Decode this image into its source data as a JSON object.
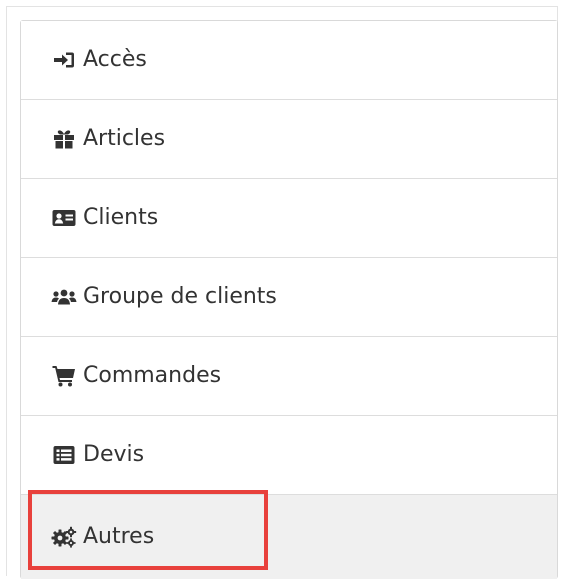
{
  "menu": {
    "items": [
      {
        "label": "Accès",
        "icon": "sign-in-icon"
      },
      {
        "label": "Articles",
        "icon": "gift-icon"
      },
      {
        "label": "Clients",
        "icon": "id-card-icon"
      },
      {
        "label": "Groupe de clients",
        "icon": "users-icon"
      },
      {
        "label": "Commandes",
        "icon": "shopping-cart-icon"
      },
      {
        "label": "Devis",
        "icon": "list-alt-icon"
      },
      {
        "label": "Autres",
        "icon": "cogs-icon",
        "active": true
      }
    ]
  },
  "colors": {
    "text": "#333333",
    "active_background": "#f0f0f0",
    "highlight_border": "#e8413c",
    "divider": "#dddddd"
  }
}
